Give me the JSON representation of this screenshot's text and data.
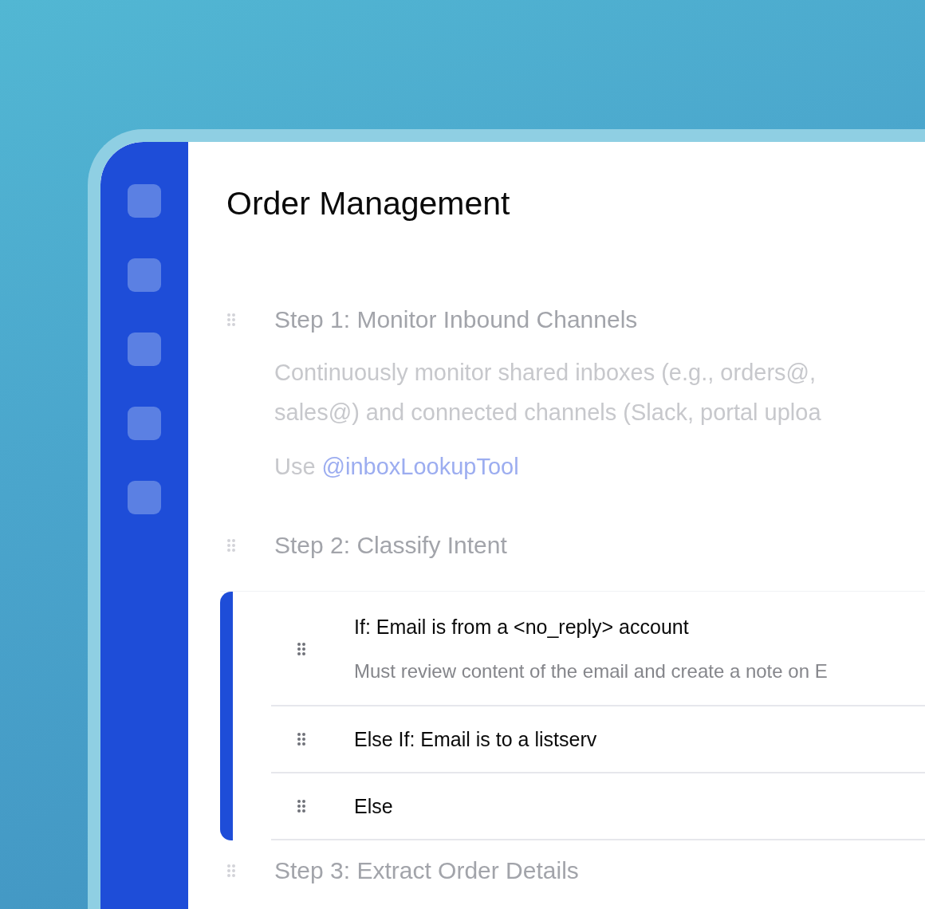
{
  "sidebar": {
    "items": [
      {
        "kind": "icon"
      },
      {
        "kind": "icon"
      },
      {
        "kind": "icon"
      },
      {
        "kind": "icon"
      },
      {
        "kind": "icon"
      }
    ]
  },
  "title": "Order Management",
  "steps": [
    {
      "title": "Step 1: Monitor Inbound Channels",
      "description_lines": [
        "Continuously monitor shared inboxes (e.g., orders@,",
        "sales@) and connected channels (Slack, portal uploa"
      ],
      "note": {
        "prefix": "Use",
        "mention": "@inboxLookupTool"
      }
    },
    {
      "title": "Step 2: Classify Intent",
      "branches": [
        {
          "condition": "If: Email is from a <no_reply> account",
          "detail": "Must review content of the email and create a note on E"
        },
        {
          "condition": "Else If: Email is to a listserv"
        },
        {
          "condition": "Else"
        }
      ]
    },
    {
      "title": "Step 3: Extract Order Details"
    }
  ]
}
